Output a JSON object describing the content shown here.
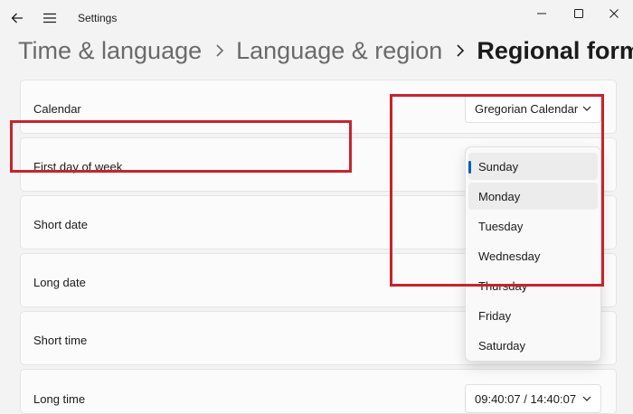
{
  "titlebar": {
    "app_title": "Settings",
    "icons": [
      "back-arrow-icon",
      "hamburger-menu-icon",
      "minimize-icon",
      "maximize-icon",
      "close-icon"
    ]
  },
  "breadcrumb": {
    "items": [
      "Time & language",
      "Language & region"
    ],
    "current": "Regional format"
  },
  "settings": {
    "calendar": {
      "label": "Calendar",
      "value": "Gregorian Calendar"
    },
    "first_day_of_week": {
      "label": "First day of week"
    },
    "short_date": {
      "label": "Short date"
    },
    "long_date": {
      "label": "Long date"
    },
    "short_time": {
      "label": "Short time"
    },
    "long_time": {
      "label": "Long time",
      "value": "09:40:07 / 14:40:07"
    }
  },
  "dropdown": {
    "selected": "Sunday",
    "hovered": "Monday",
    "options": [
      "Sunday",
      "Monday",
      "Tuesday",
      "Wednesday",
      "Thursday",
      "Friday",
      "Saturday"
    ]
  },
  "colors": {
    "accent": "#005fb8",
    "annotation_red": "#c8232c",
    "page_background": "#f3f3f3",
    "card_background": "#fbfbfb"
  }
}
